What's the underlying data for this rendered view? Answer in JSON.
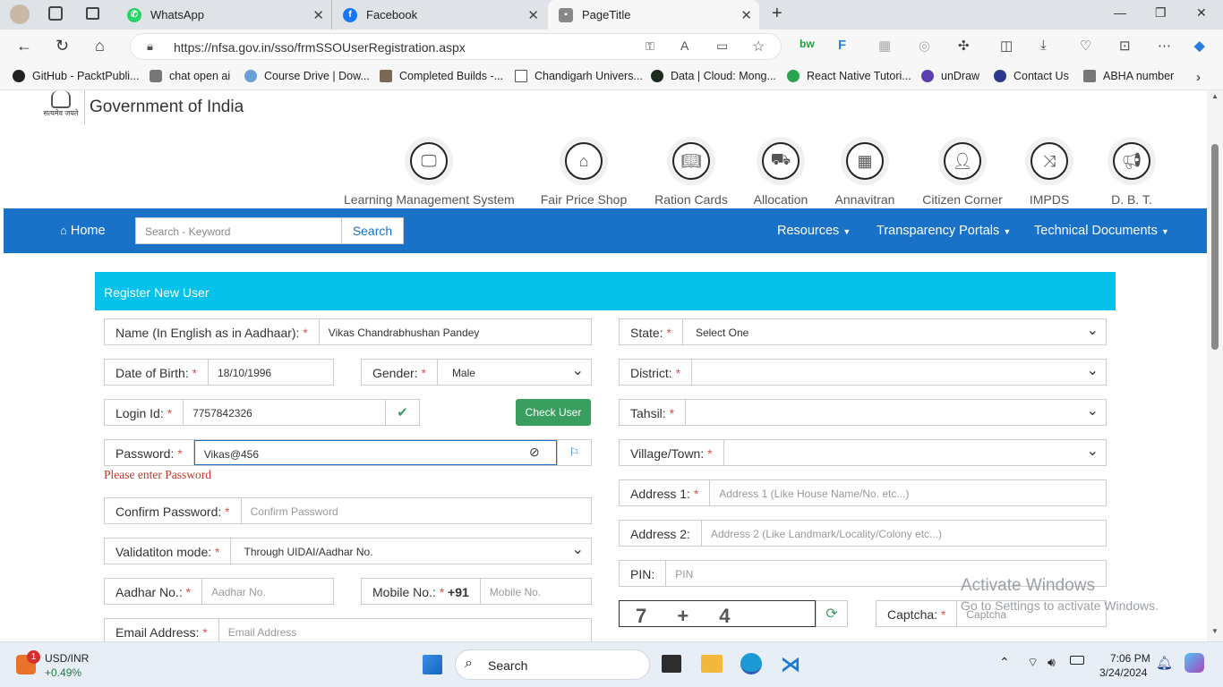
{
  "browser": {
    "tabs": [
      {
        "label": "WhatsApp"
      },
      {
        "label": "Facebook"
      },
      {
        "label": "PageTitle"
      }
    ],
    "url": "https://nfsa.gov.in/sso/frmSSOUserRegistration.aspx",
    "bookmarks": [
      "GitHub - PacktPubli...",
      "chat open ai",
      "Course Drive | Dow...",
      "Completed Builds -...",
      "Chandigarh Univers...",
      "Data | Cloud: Mong...",
      "React Native Tutori...",
      "unDraw",
      "Contact Us",
      "ABHA number"
    ]
  },
  "header": {
    "emblem_text": "सत्यमेव जयते",
    "govt": "Government of India"
  },
  "top_icons": [
    {
      "label": "Learning Management System",
      "icon": "monitor-book-icon"
    },
    {
      "label": "Fair Price Shop",
      "icon": "shop-icon"
    },
    {
      "label": "Ration Cards",
      "icon": "book-icon"
    },
    {
      "label": "Allocation",
      "icon": "truck-icon"
    },
    {
      "label": "Annavitran",
      "icon": "pos-machine-icon"
    },
    {
      "label": "Citizen Corner",
      "icon": "user-icon"
    },
    {
      "label": "IMPDS",
      "icon": "shuffle-icon"
    },
    {
      "label": "D. B. T.",
      "icon": "megaphone-icon"
    }
  ],
  "nav": {
    "home": "Home",
    "search_placeholder": "Search - Keyword",
    "search_button": "Search",
    "resources": "Resources",
    "transparency": "Transparency Portals",
    "technical": "Technical Documents"
  },
  "form": {
    "title": "Register New User",
    "name_label": "Name (In English as in Aadhaar):",
    "name_value": "Vikas Chandrabhushan Pandey",
    "dob_label": "Date of Birth:",
    "dob_value": "18/10/1996",
    "gender_label": "Gender:",
    "gender_value": "Male",
    "login_label": "Login Id:",
    "login_value": "7757842326",
    "check_user": "Check User",
    "password_label": "Password:",
    "password_value": "Vikas@456",
    "password_error": "Please enter Password",
    "confirm_label": "Confirm Password:",
    "confirm_placeholder": "Confirm Password",
    "validation_label": "Validatiton mode:",
    "validation_value": "Through UIDAI/Aadhar No.",
    "aadhar_label": "Aadhar No.:",
    "aadhar_placeholder": "Aadhar No.",
    "mobile_label": "Mobile No.:",
    "mobile_prefix": "+91",
    "mobile_placeholder": "Mobile No.",
    "email_label": "Email Address:",
    "email_placeholder": "Email Address",
    "state_label": "State:",
    "state_value": "Select One",
    "district_label": "District:",
    "tahsil_label": "Tahsil:",
    "village_label": "Village/Town:",
    "address1_label": "Address 1:",
    "address1_placeholder": "Address 1 (Like House Name/No. etc...)",
    "address2_label": "Address 2:",
    "address2_placeholder": "Address 2 (Like Landmark/Locality/Colony etc...)",
    "pin_label": "PIN:",
    "pin_placeholder": "PIN",
    "captcha_text": "7 + 4",
    "captcha_label": "Captcha:",
    "captcha_placeholder": "Captcha"
  },
  "watermark": {
    "line1": "Activate Windows",
    "line2": "Go to Settings to activate Windows."
  },
  "taskbar": {
    "stock_badge": "1",
    "stock_name": "USD/INR",
    "stock_change": "+0.49%",
    "search": "Search",
    "time": "7:06 PM",
    "date": "3/24/2024"
  },
  "colors": {
    "nav_blue": "#1a72c8",
    "panel_cyan": "#06c2ea",
    "check_green": "#3a9e5f",
    "error_red": "#c0392b"
  }
}
